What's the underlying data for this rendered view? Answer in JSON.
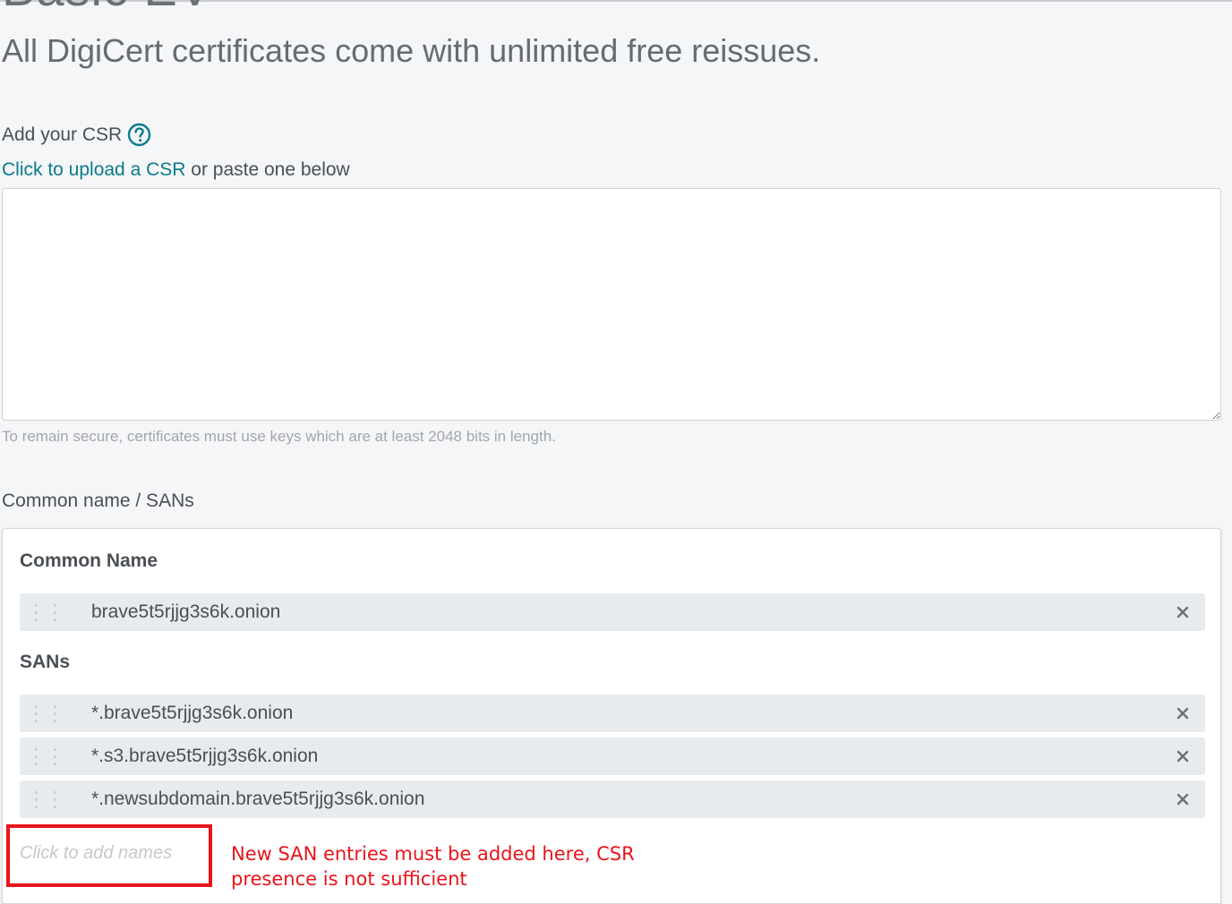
{
  "product_title": "Basic EV",
  "subtitle": "All DigiCert certificates come with unlimited free reissues.",
  "csr": {
    "heading": "Add your CSR",
    "upload_link": "Click to upload a CSR",
    "upload_suffix": " or paste one below",
    "textarea_value": "",
    "key_hint": "To remain secure, certificates must use keys which are at least 2048 bits in length."
  },
  "names": {
    "heading": "Common name / SANs",
    "common_name_label": "Common Name",
    "common_name": "brave5t5rjjg3s6k.onion",
    "sans_label": "SANs",
    "sans": [
      "*.brave5t5rjjg3s6k.onion",
      "*.s3.brave5t5rjjg3s6k.onion",
      "*.newsubdomain.brave5t5rjjg3s6k.onion"
    ],
    "add_placeholder": "Click to add names"
  },
  "annotation": {
    "text": "New SAN entries must be added here, CSR presence is not sufficient",
    "color": "#e8141a"
  },
  "colors": {
    "link": "#0a7b8c",
    "row_bg": "#e8ebee",
    "page_bg": "#f5f6f8"
  },
  "icons": {
    "help": "help-circle-icon",
    "drag": "drag-handle-icon",
    "remove": "close-icon"
  }
}
